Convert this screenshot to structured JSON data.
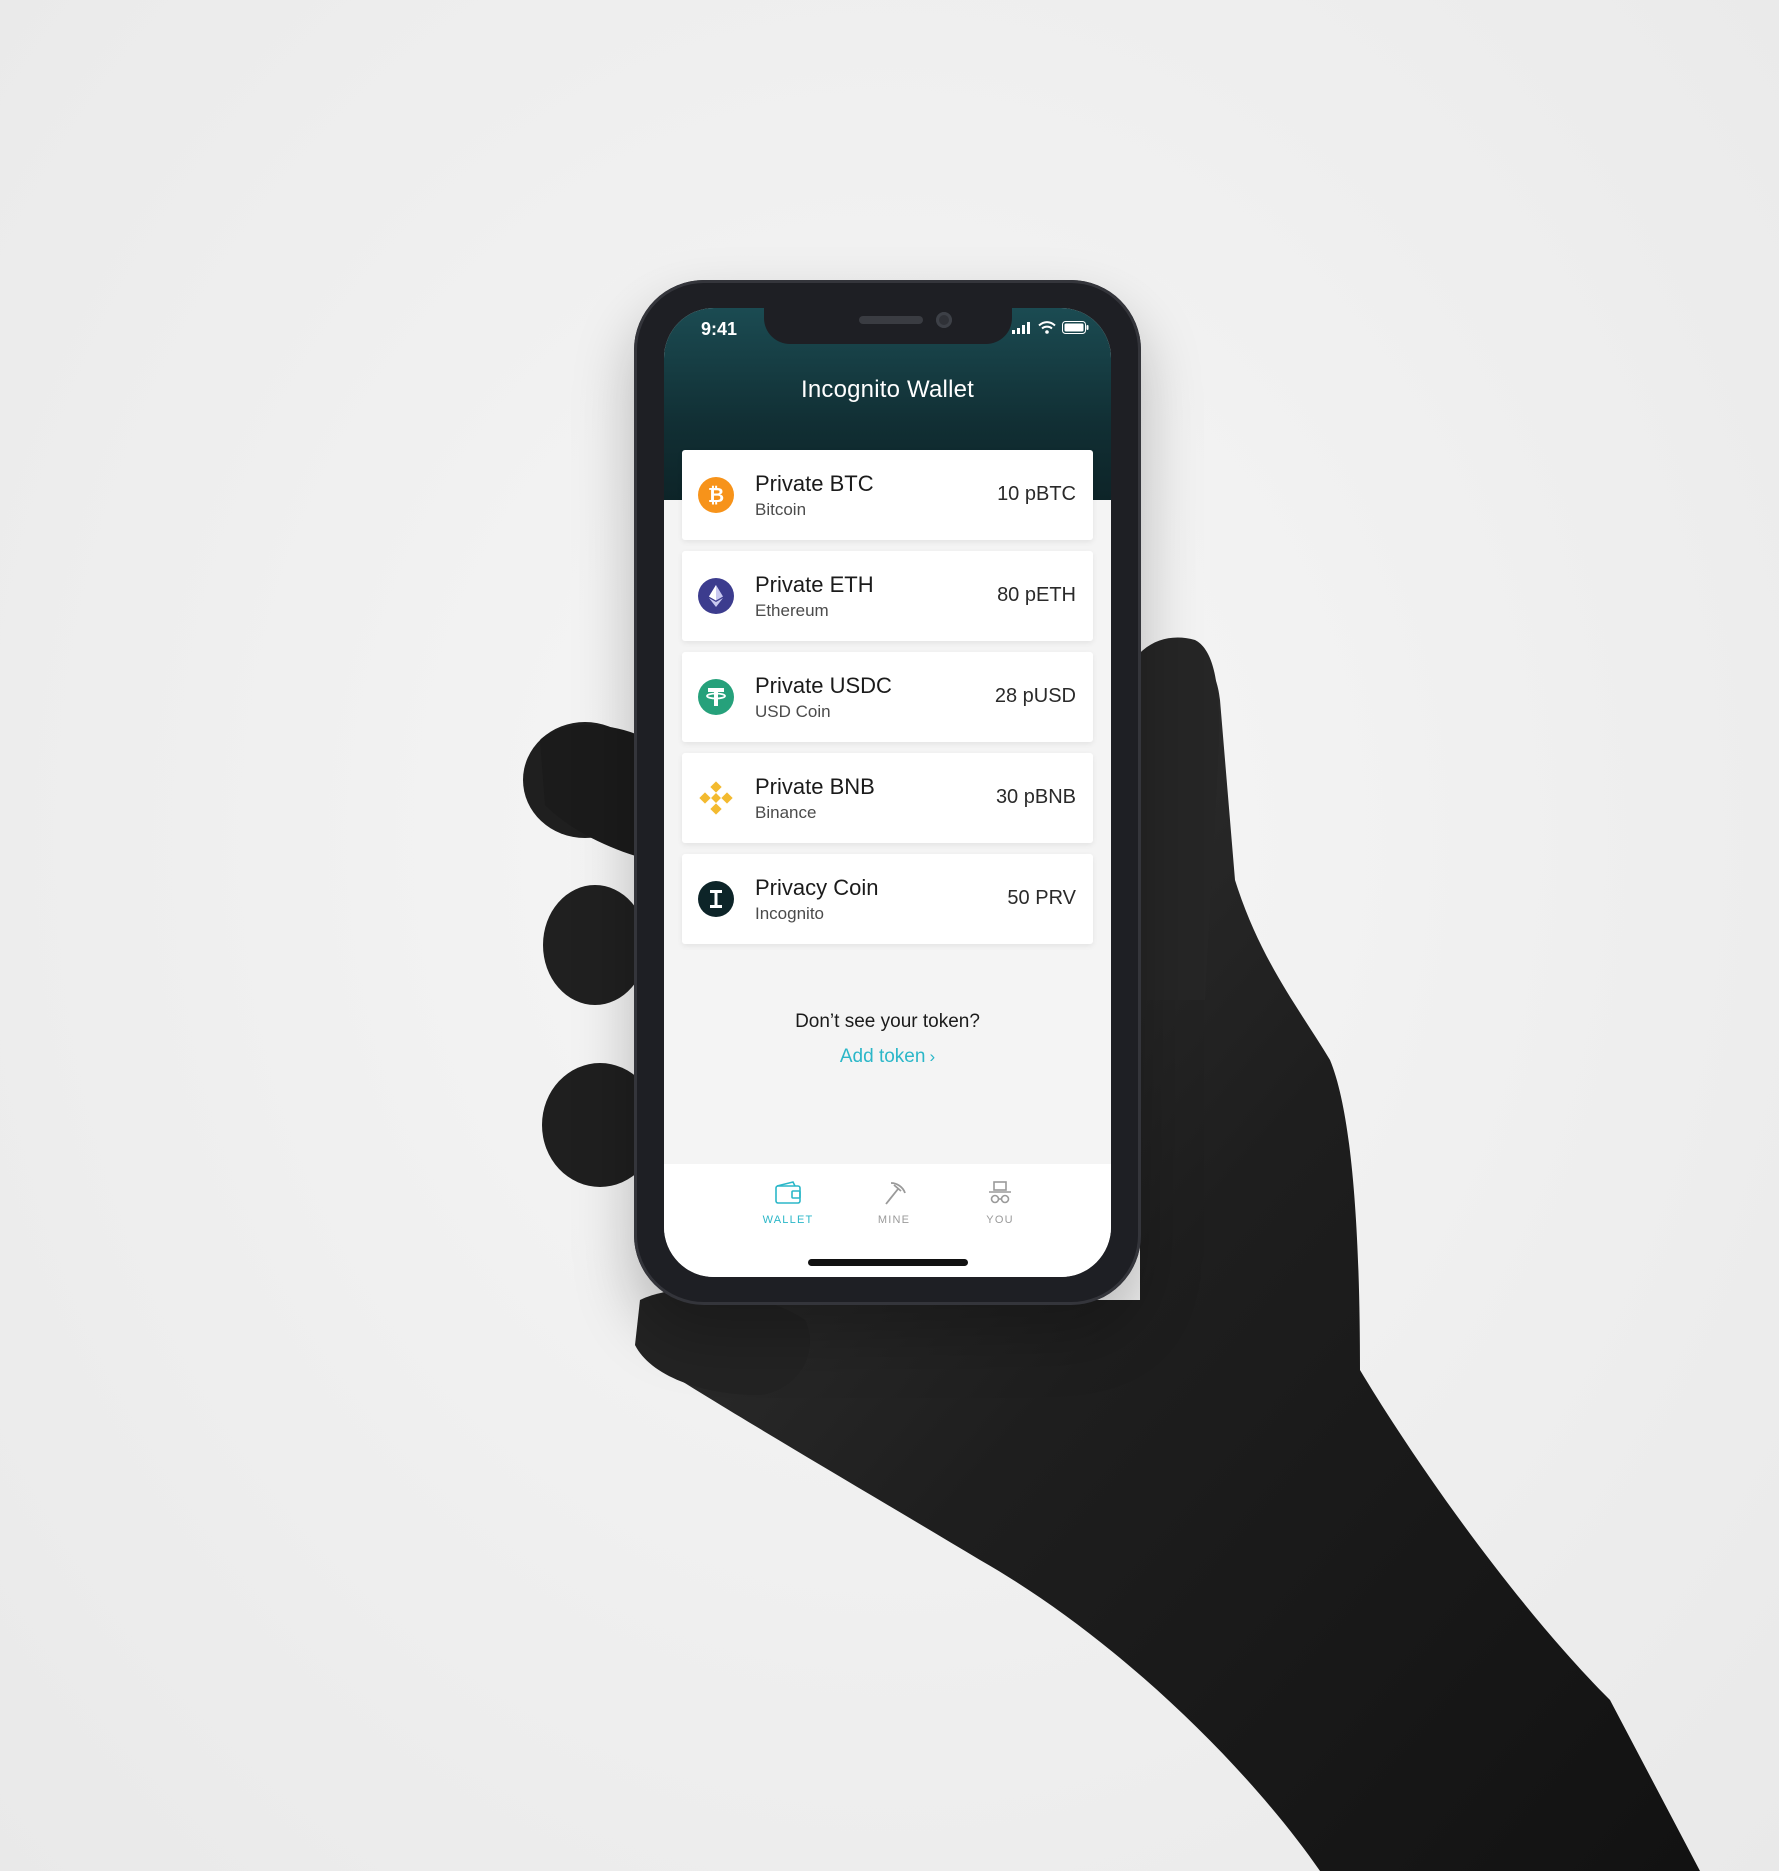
{
  "status_bar": {
    "time": "9:41",
    "icons": [
      "signal-icon",
      "wifi-icon",
      "battery-icon"
    ]
  },
  "header": {
    "title": "Incognito Wallet"
  },
  "tokens": [
    {
      "name": "Private BTC",
      "subtitle": "Bitcoin",
      "balance": "10 pBTC",
      "icon": "bitcoin-icon",
      "color": "#f7931a"
    },
    {
      "name": "Private ETH",
      "subtitle": "Ethereum",
      "balance": "80 pETH",
      "icon": "ethereum-icon",
      "color": "#3c3c8e"
    },
    {
      "name": "Private USDC",
      "subtitle": "USD Coin",
      "balance": "28 pUSD",
      "icon": "usd-coin-icon",
      "color": "#26a17b"
    },
    {
      "name": "Private BNB",
      "subtitle": "Binance",
      "balance": "30 pBNB",
      "icon": "binance-icon",
      "color": "#f3ba2f"
    },
    {
      "name": "Privacy Coin",
      "subtitle": "Incognito",
      "balance": "50 PRV",
      "icon": "incognito-icon",
      "color": "#0d2428"
    }
  ],
  "add_token": {
    "prompt": "Don’t see your token?",
    "link_label": "Add token"
  },
  "tabbar": {
    "tabs": [
      {
        "label": "WALLET",
        "icon": "wallet-icon",
        "active": true
      },
      {
        "label": "MINE",
        "icon": "pickaxe-icon",
        "active": false
      },
      {
        "label": "YOU",
        "icon": "incognito-user-icon",
        "active": false
      }
    ]
  },
  "colors": {
    "header_dark": "#0d2428",
    "accent": "#2bb7c8",
    "background": "#f4f4f4"
  }
}
